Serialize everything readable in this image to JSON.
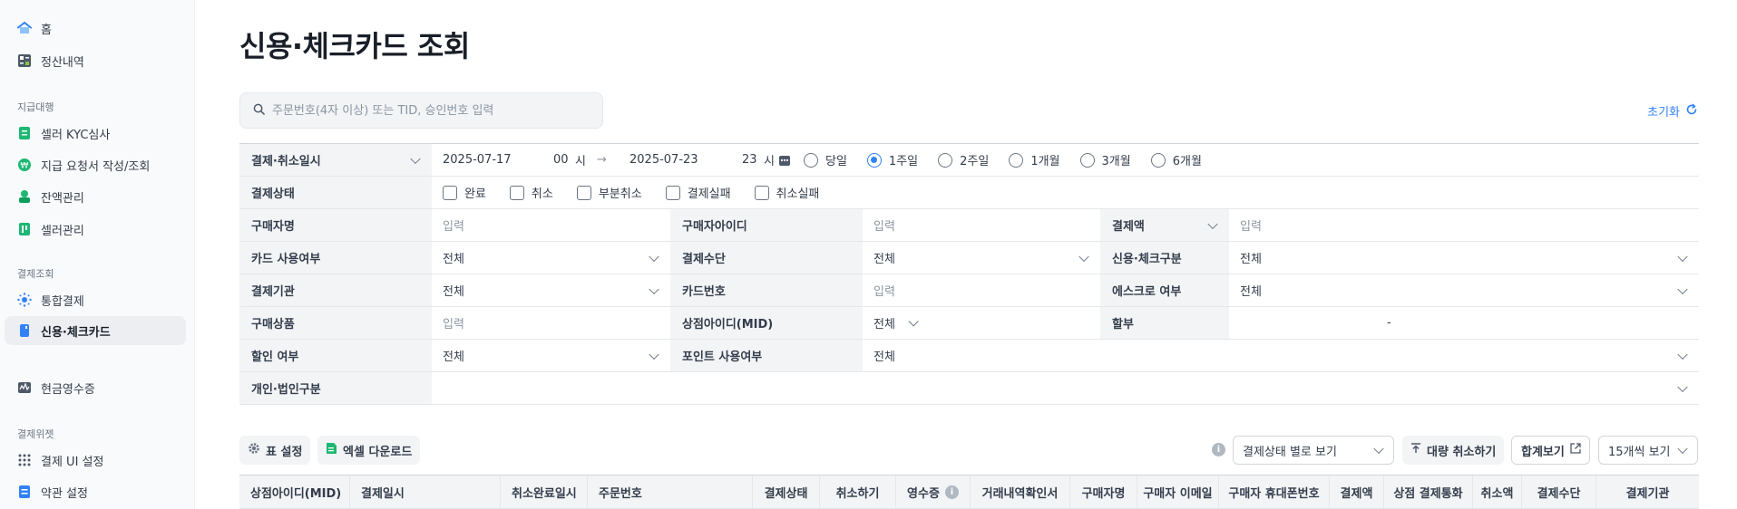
{
  "sidebar": {
    "items_top": [
      {
        "label": "홈",
        "icon": "home-icon"
      },
      {
        "label": "정산내역",
        "icon": "calculator-icon"
      }
    ],
    "section_payout": "지급대행",
    "items_payout": [
      {
        "label": "셀러 KYC심사",
        "icon": "clipboard-icon"
      },
      {
        "label": "지급 요청서 작성/조회",
        "icon": "won-coin-icon"
      },
      {
        "label": "잔액관리",
        "icon": "balance-icon"
      },
      {
        "label": "셀러관리",
        "icon": "seller-icon"
      }
    ],
    "section_payment": "결제조회",
    "items_payment": [
      {
        "label": "통합결제",
        "icon": "sparkle-icon"
      },
      {
        "label": "신용·체크카드",
        "icon": "card-icon",
        "active": true
      },
      {
        "label": "현금영수증",
        "icon": "receipt-icon"
      }
    ],
    "section_widget": "결제위젯",
    "items_widget": [
      {
        "label": "결제 UI 설정",
        "icon": "grid-dots-icon"
      },
      {
        "label": "약관 설정",
        "icon": "document-icon"
      }
    ]
  },
  "page": {
    "title": "신용·체크카드 조회",
    "search_placeholder": "주문번호(4자 이상) 또는 TID, 승인번호 입력",
    "reset_label": "초기화"
  },
  "filter": {
    "date_type": "결제·취소일시",
    "start_date": "2025-07-17",
    "start_hour": "00",
    "end_date": "2025-07-23",
    "end_hour": "23",
    "hour_unit": "시",
    "arrow": "→",
    "ranges": [
      "당일",
      "1주일",
      "2주일",
      "1개월",
      "3개월",
      "6개월"
    ],
    "selected_range": "1주일",
    "status_label": "결제상태",
    "statuses": [
      "완료",
      "취소",
      "부분취소",
      "결제실패",
      "취소실패"
    ],
    "buyer_name_label": "구매자명",
    "buyer_id_label": "구매자아이디",
    "amount_label": "결제액",
    "input_placeholder": "입력",
    "card_use_label": "카드 사용여부",
    "pay_method_label": "결제수단",
    "credit_check_label": "신용·체크구분",
    "all_label": "전체",
    "institution_label": "결제기관",
    "card_number_label": "카드번호",
    "escrow_label": "에스크로 여부",
    "product_label": "구매상품",
    "mid_label": "상점아이디(MID)",
    "installment_label": "할부",
    "installment_value": "-",
    "discount_label": "할인 여부",
    "point_label": "포인트 사용여부",
    "entity_label": "개인·법인구분"
  },
  "toolbar": {
    "table_settings": "표 설정",
    "excel_download": "엑셀 다운로드",
    "status_view": "결제상태 별로 보기",
    "bulk_cancel": "대량 취소하기",
    "sum_view": "합계보기",
    "page_size": "15개씩 보기"
  },
  "columns": [
    "상점아이디(MID)",
    "결제일시",
    "취소완료일시",
    "주문번호",
    "결제상태",
    "취소하기",
    "영수증",
    "거래내역확인서",
    "구매자명",
    "구매자 이메일",
    "구매자 휴대폰번호",
    "결제액",
    "상점 결제통화",
    "취소액",
    "결제수단",
    "결제기관"
  ],
  "colors": {
    "accent": "#3182f6",
    "label_bg": "#f2f4f6",
    "sidebar_bg": "#f9fafb"
  }
}
